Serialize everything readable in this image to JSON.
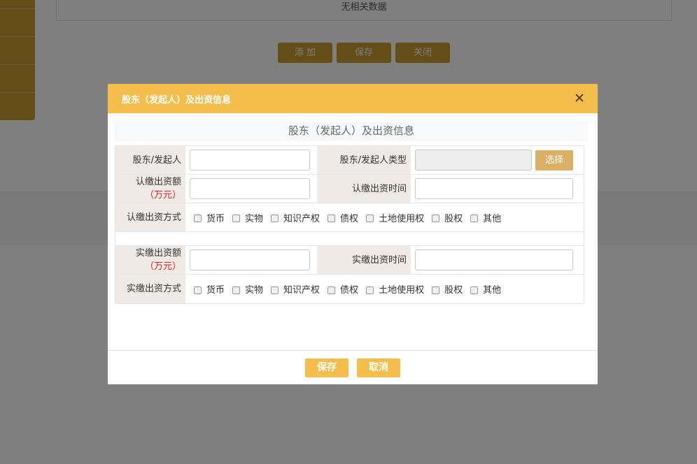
{
  "background": {
    "table_empty_text": "无相关数据",
    "buttons": [
      "添 加",
      "保存",
      "关闭"
    ]
  },
  "modal": {
    "title": "股东（发起人）及出资信息",
    "heading": "股东（发起人）及出资信息",
    "fields": {
      "shareholder_label": "股东/发起人",
      "shareholder_value": "",
      "shareholder_type_label": "股东/发起人类型",
      "shareholder_type_value": "",
      "select_button": "选择",
      "subscribed_amount_label": "认缴出资额",
      "subscribed_amount_unit": "（万元）",
      "subscribed_amount_value": "",
      "subscribed_time_label": "认缴出资时间",
      "subscribed_time_value": "",
      "subscribed_method_label": "认缴出资方式",
      "paid_amount_label": "实缴出资额",
      "paid_amount_unit": "（万元）",
      "paid_amount_value": "",
      "paid_time_label": "实缴出资时间",
      "paid_time_value": "",
      "paid_method_label": "实缴出资方式"
    },
    "contribution_methods": [
      "货币",
      "实物",
      "知识产权",
      "债权",
      "土地使用权",
      "股权",
      "其他"
    ],
    "footer": {
      "save": "保存",
      "cancel": "取消"
    }
  },
  "colors": {
    "header": "#f4bd4c",
    "accent_button": "#d9b064",
    "label_bg": "#efeae6",
    "unit_text": "#e02020"
  }
}
